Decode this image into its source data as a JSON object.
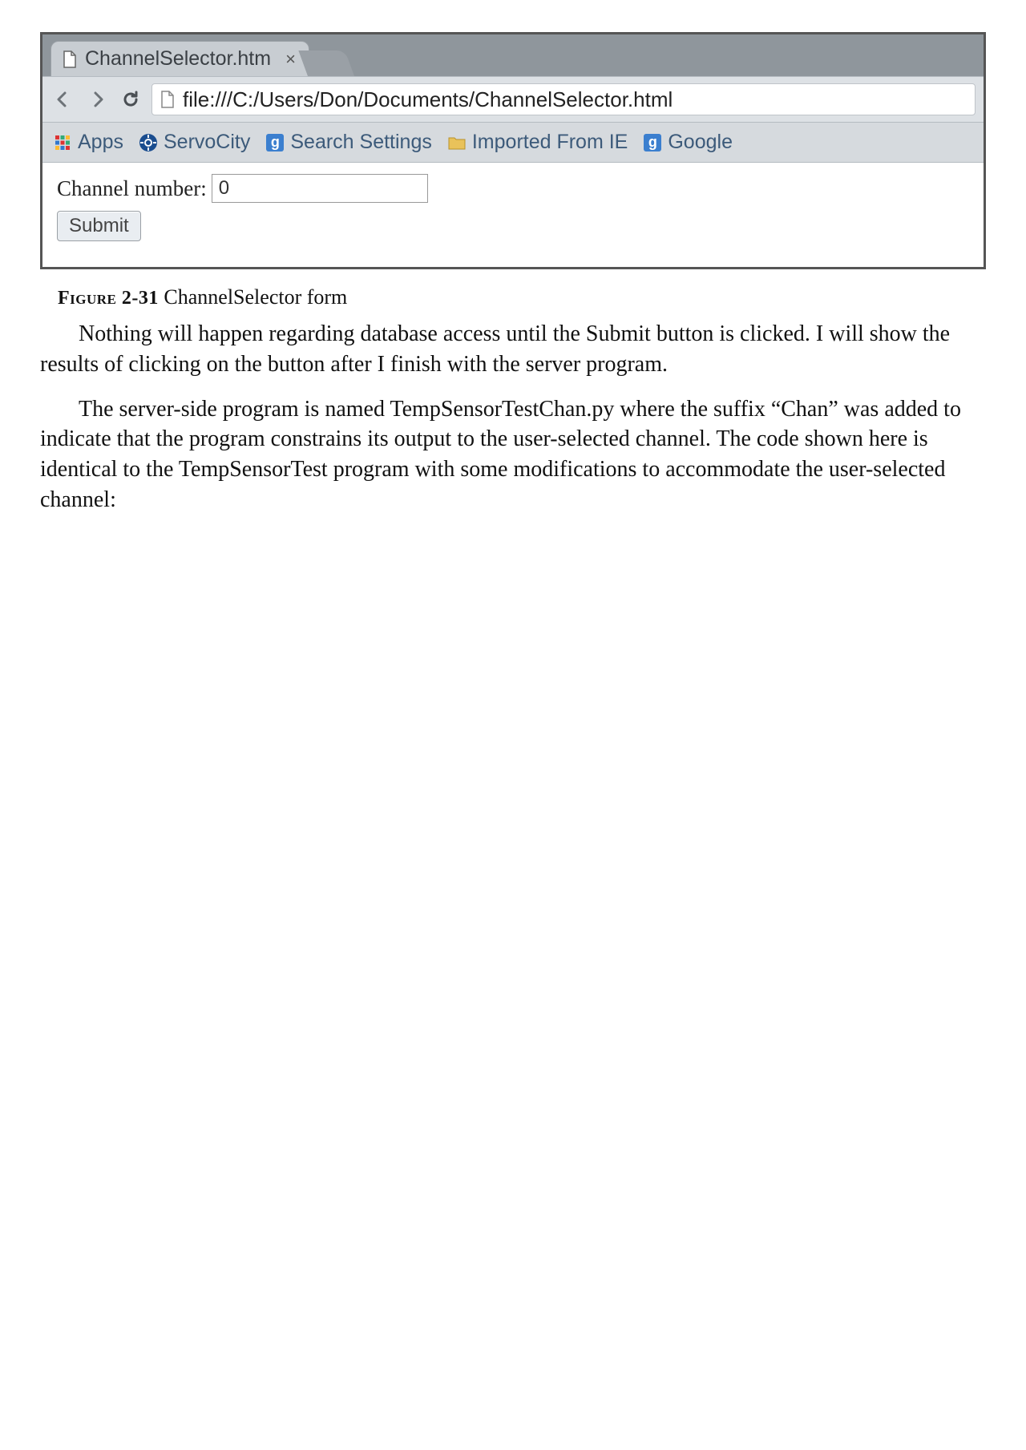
{
  "browser": {
    "tab_title": "ChannelSelector.htm",
    "url": "file:///C:/Users/Don/Documents/ChannelSelector.html",
    "bookmarks": [
      {
        "label": "Apps",
        "icon": "apps-icon"
      },
      {
        "label": "ServoCity",
        "icon": "servocity-icon"
      },
      {
        "label": "Search Settings",
        "icon": "google-g-icon"
      },
      {
        "label": "Imported From IE",
        "icon": "folder-icon"
      },
      {
        "label": "Google",
        "icon": "google-g-icon"
      }
    ]
  },
  "form": {
    "label": "Channel number:",
    "value": "0",
    "submit_label": "Submit"
  },
  "caption": {
    "fig_label": "Figure",
    "fig_number": "2-31",
    "fig_text": "ChannelSelector form"
  },
  "paragraphs": [
    "Nothing will happen regarding database access until the Submit button is clicked. I will show the results of clicking on the button after I finish with the server program.",
    "The server-side program is named TempSensorTestChan.py where the suffix “Chan” was added to indicate that the program constrains its output to the user-selected channel. The code shown here is identical to the TempSensorTest program with some modifications to accommodate the user-selected channel:"
  ]
}
